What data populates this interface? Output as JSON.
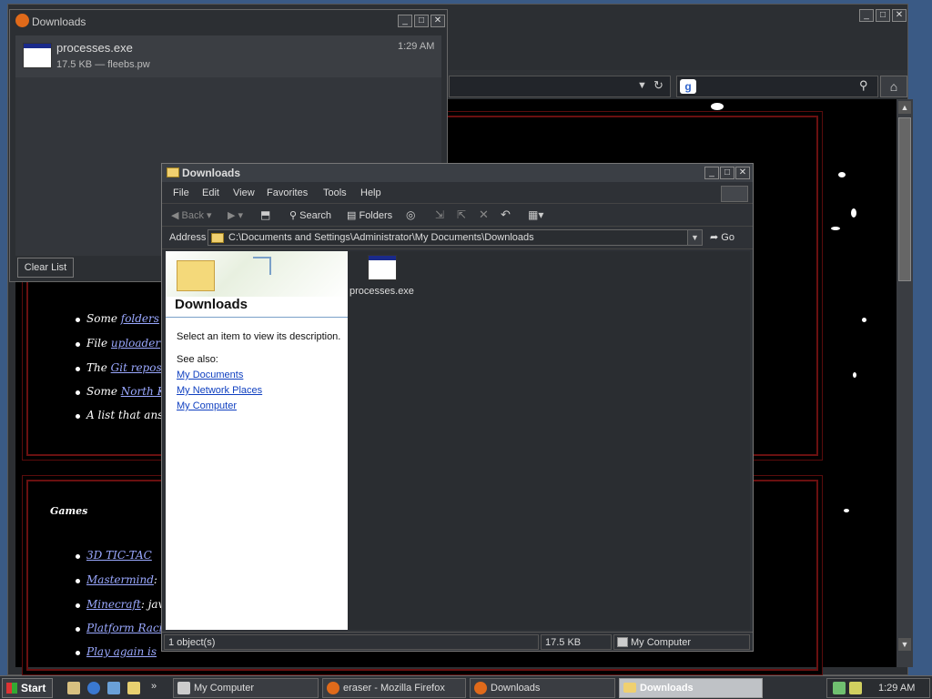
{
  "firefox": {
    "search_engine_icon": "google-icon",
    "home_icon": "home-icon",
    "page": {
      "list1": [
        {
          "prefix": "Some ",
          "link": "folders",
          "suffix": " y"
        },
        {
          "prefix": "File ",
          "link": "uploader",
          "suffix": ""
        },
        {
          "prefix": "The ",
          "link": "Git repos",
          "suffix": ""
        },
        {
          "prefix": "Some ",
          "link": "North K",
          "suffix": ""
        },
        {
          "prefix": "A list that answ",
          "link": "",
          "suffix": ""
        }
      ],
      "games_heading": "Games",
      "list2": [
        {
          "link": "3D TIC-TAC",
          "suffix": ""
        },
        {
          "link": "Mastermind",
          "suffix": ": p"
        },
        {
          "link": "Minecraft",
          "suffix": ": java"
        },
        {
          "link": "Platform Racin",
          "suffix": ""
        },
        {
          "link": "Play again is",
          "suffix": ""
        }
      ]
    }
  },
  "downloads_window": {
    "title": "Downloads",
    "item": {
      "name": "processes.exe",
      "details": "17.5 KB — fleebs.pw",
      "time": "1:29 AM"
    },
    "clear_button": "Clear List"
  },
  "explorer": {
    "title": "Downloads",
    "menu": [
      "File",
      "Edit",
      "View",
      "Favorites",
      "Tools",
      "Help"
    ],
    "toolbar": {
      "back": "Back",
      "search": "Search",
      "folders": "Folders"
    },
    "address_label": "Address",
    "address_value": "C:\\Documents and Settings\\Administrator\\My Documents\\Downloads",
    "go_label": "Go",
    "left_pane": {
      "heading": "Downloads",
      "description": "Select an item to view its description.",
      "see_also": "See also:",
      "links": [
        "My Documents",
        "My Network Places",
        "My Computer"
      ]
    },
    "file": {
      "name": "processes.exe"
    },
    "status": {
      "objects": "1 object(s)",
      "size": "17.5 KB",
      "zone": "My Computer"
    }
  },
  "taskbar": {
    "start": "Start",
    "tasks": [
      {
        "label": "My Computer",
        "active": false
      },
      {
        "label": "eraser - Mozilla Firefox",
        "active": false
      },
      {
        "label": "Downloads",
        "active": false
      },
      {
        "label": "Downloads",
        "active": true
      }
    ],
    "clock": "1:29 AM"
  },
  "colors": {
    "accent_link": "#9aa8ff",
    "xp_link": "#1040c0",
    "panel_border": "#6a1010"
  }
}
